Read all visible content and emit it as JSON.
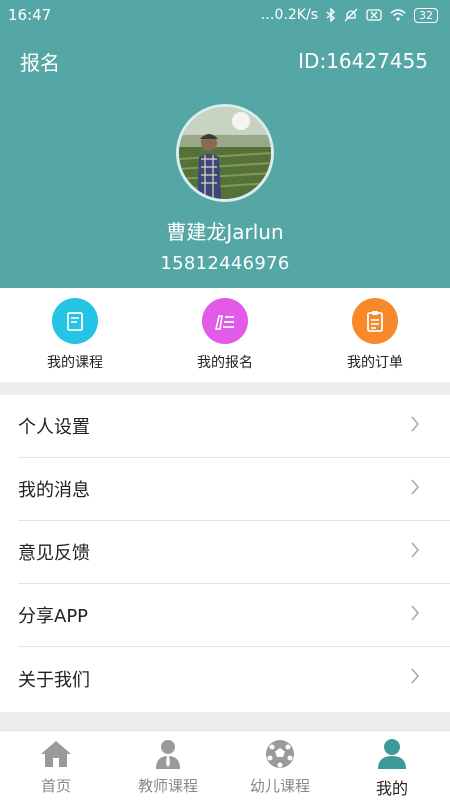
{
  "status_bar": {
    "time": "16:47",
    "net_speed": "0.2K/s",
    "battery": "32"
  },
  "header": {
    "title": "报名",
    "user_id": "ID:16427455"
  },
  "profile": {
    "name": "曹建龙Jarlun",
    "phone": "15812446976"
  },
  "quick_actions": [
    {
      "label": "我的课程",
      "icon": "book-icon",
      "color": "#23c4e5"
    },
    {
      "label": "我的报名",
      "icon": "pencil-list-icon",
      "color": "#e15ae8"
    },
    {
      "label": "我的订单",
      "icon": "clipboard-icon",
      "color": "#f7892b"
    }
  ],
  "menu": [
    {
      "label": "个人设置"
    },
    {
      "label": "我的消息"
    },
    {
      "label": "意见反馈"
    },
    {
      "label": "分享APP"
    },
    {
      "label": "关于我们"
    }
  ],
  "tabs": [
    {
      "label": "首页",
      "icon": "home-icon",
      "active": false
    },
    {
      "label": "教师课程",
      "icon": "teacher-icon",
      "active": false
    },
    {
      "label": "幼儿课程",
      "icon": "soccer-ball-icon",
      "active": false
    },
    {
      "label": "我的",
      "icon": "user-icon",
      "active": true
    }
  ],
  "colors": {
    "header_bg": "#55a7a6",
    "active_tab": "#3d9a9a",
    "inactive_tab": "#9a9a9a"
  }
}
